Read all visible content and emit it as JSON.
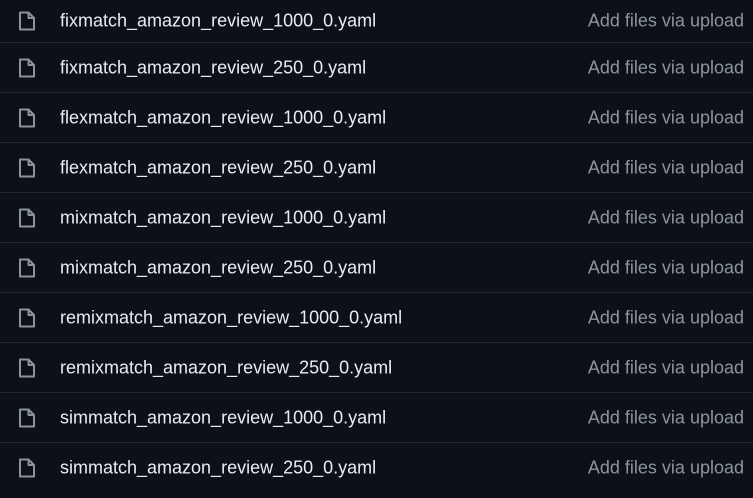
{
  "files": [
    {
      "name": "fixmatch_amazon_review_1000_0.yaml",
      "commit_message": "Add files via upload",
      "icon": "file-icon"
    },
    {
      "name": "fixmatch_amazon_review_250_0.yaml",
      "commit_message": "Add files via upload",
      "icon": "file-icon"
    },
    {
      "name": "flexmatch_amazon_review_1000_0.yaml",
      "commit_message": "Add files via upload",
      "icon": "file-icon"
    },
    {
      "name": "flexmatch_amazon_review_250_0.yaml",
      "commit_message": "Add files via upload",
      "icon": "file-icon"
    },
    {
      "name": "mixmatch_amazon_review_1000_0.yaml",
      "commit_message": "Add files via upload",
      "icon": "file-icon"
    },
    {
      "name": "mixmatch_amazon_review_250_0.yaml",
      "commit_message": "Add files via upload",
      "icon": "file-icon"
    },
    {
      "name": "remixmatch_amazon_review_1000_0.yaml",
      "commit_message": "Add files via upload",
      "icon": "file-icon"
    },
    {
      "name": "remixmatch_amazon_review_250_0.yaml",
      "commit_message": "Add files via upload",
      "icon": "file-icon"
    },
    {
      "name": "simmatch_amazon_review_1000_0.yaml",
      "commit_message": "Add files via upload",
      "icon": "file-icon"
    },
    {
      "name": "simmatch_amazon_review_250_0.yaml",
      "commit_message": "Add files via upload",
      "icon": "file-icon"
    }
  ],
  "colors": {
    "background": "#0d1117",
    "divider": "#21262d",
    "file_name": "#e6edf3",
    "commit_message": "#8b949e",
    "icon": "#8b949e"
  }
}
